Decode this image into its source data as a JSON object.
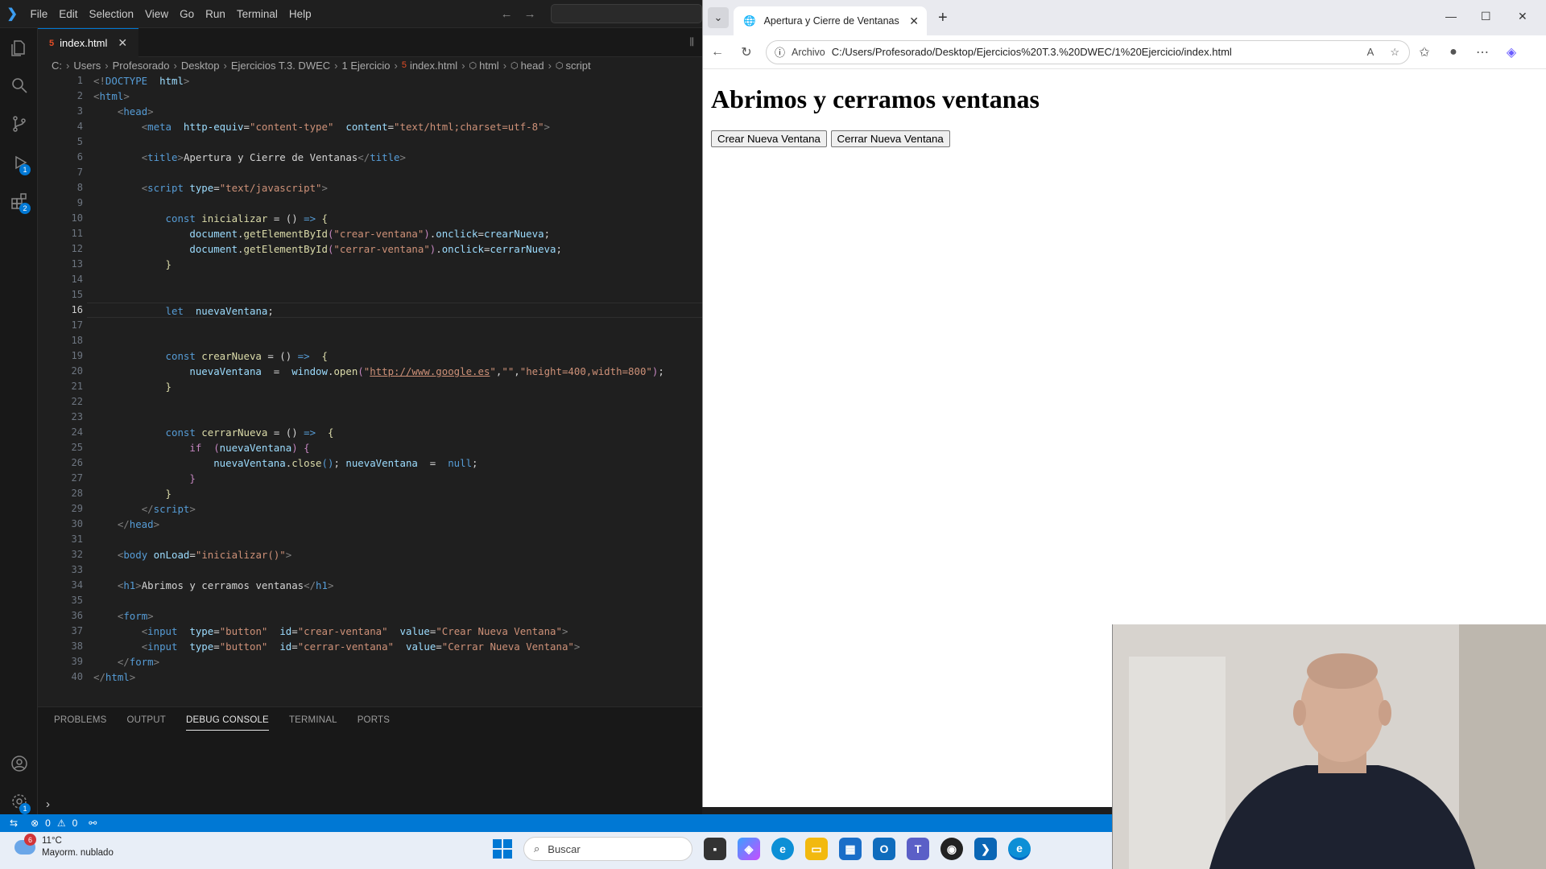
{
  "vscode": {
    "menu": [
      "File",
      "Edit",
      "Selection",
      "View",
      "Go",
      "Run",
      "Terminal",
      "Help"
    ],
    "tab": {
      "filename": "index.html"
    },
    "breadcrumb": {
      "c": "C:",
      "users": "Users",
      "prof": "Profesorado",
      "desk": "Desktop",
      "ej": "Ejercicios T.3. DWEC",
      "ej1": "1 Ejercicio",
      "file": "index.html",
      "html": "html",
      "head": "head",
      "script": "script"
    },
    "activity_badges": {
      "debug": "1",
      "extensions": "2",
      "settings": "1"
    },
    "current_line": 16,
    "panel_tabs": [
      "PROBLEMS",
      "OUTPUT",
      "DEBUG CONSOLE",
      "TERMINAL",
      "PORTS"
    ],
    "active_panel_tab": "DEBUG CONSOLE",
    "status": {
      "errors": "0",
      "warnings": "0"
    },
    "code": [
      [
        [
          "t",
          "<!"
        ],
        [
          "tg",
          "DOCTYPE"
        ],
        [
          "tx",
          "  "
        ],
        [
          "at",
          "html"
        ],
        [
          "t",
          ">"
        ]
      ],
      [
        [
          "t",
          "<"
        ],
        [
          "tg",
          "html"
        ],
        [
          "t",
          ">"
        ]
      ],
      [
        [
          "tx",
          "    "
        ],
        [
          "t",
          "<"
        ],
        [
          "tg",
          "head"
        ],
        [
          "t",
          ">"
        ]
      ],
      [
        [
          "tx",
          "        "
        ],
        [
          "t",
          "<"
        ],
        [
          "tg",
          "meta"
        ],
        [
          "tx",
          "  "
        ],
        [
          "at",
          "http-equiv"
        ],
        [
          "tx",
          "="
        ],
        [
          "st",
          "\"content-type\""
        ],
        [
          "tx",
          "  "
        ],
        [
          "at",
          "content"
        ],
        [
          "tx",
          "="
        ],
        [
          "st",
          "\"text/html;charset=utf-8\""
        ],
        [
          "t",
          ">"
        ]
      ],
      [],
      [
        [
          "tx",
          "        "
        ],
        [
          "t",
          "<"
        ],
        [
          "tg",
          "title"
        ],
        [
          "t",
          ">"
        ],
        [
          "tx",
          "Apertura y Cierre de Ventanas"
        ],
        [
          "t",
          "</"
        ],
        [
          "tg",
          "title"
        ],
        [
          "t",
          ">"
        ]
      ],
      [],
      [
        [
          "tx",
          "        "
        ],
        [
          "t",
          "<"
        ],
        [
          "tg",
          "script"
        ],
        [
          "tx",
          " "
        ],
        [
          "at",
          "type"
        ],
        [
          "tx",
          "="
        ],
        [
          "st",
          "\"text/javascript\""
        ],
        [
          "t",
          ">"
        ]
      ],
      [],
      [
        [
          "tx",
          "            "
        ],
        [
          "kw",
          "const "
        ],
        [
          "fn",
          "inicializar"
        ],
        [
          "tx",
          " = () "
        ],
        [
          "kw",
          "=>"
        ],
        [
          "tx",
          " "
        ],
        [
          "fn",
          "{"
        ]
      ],
      [
        [
          "tx",
          "                "
        ],
        [
          "vr",
          "document"
        ],
        [
          "tx",
          "."
        ],
        [
          "fn",
          "getElementById"
        ],
        [
          "ct",
          "("
        ],
        [
          "st",
          "\"crear-ventana\""
        ],
        [
          "ct",
          ")"
        ],
        [
          "tx",
          "."
        ],
        [
          "vr",
          "onclick"
        ],
        [
          "tx",
          "="
        ],
        [
          "vr",
          "crearNueva"
        ],
        [
          "tx",
          ";"
        ]
      ],
      [
        [
          "tx",
          "                "
        ],
        [
          "vr",
          "document"
        ],
        [
          "tx",
          "."
        ],
        [
          "fn",
          "getElementById"
        ],
        [
          "ct",
          "("
        ],
        [
          "st",
          "\"cerrar-ventana\""
        ],
        [
          "ct",
          ")"
        ],
        [
          "tx",
          "."
        ],
        [
          "vr",
          "onclick"
        ],
        [
          "tx",
          "="
        ],
        [
          "vr",
          "cerrarNueva"
        ],
        [
          "tx",
          ";"
        ]
      ],
      [
        [
          "tx",
          "            "
        ],
        [
          "fn",
          "}"
        ]
      ],
      [],
      [],
      [
        [
          "tx",
          "            "
        ],
        [
          "kw",
          "let"
        ],
        [
          "tx",
          "  "
        ],
        [
          "vr",
          "nuevaVentana"
        ],
        [
          "tx",
          ";"
        ]
      ],
      [],
      [],
      [
        [
          "tx",
          "            "
        ],
        [
          "kw",
          "const "
        ],
        [
          "fn",
          "crearNueva"
        ],
        [
          "tx",
          " = () "
        ],
        [
          "kw",
          "=>"
        ],
        [
          "tx",
          "  "
        ],
        [
          "fn",
          "{"
        ]
      ],
      [
        [
          "tx",
          "                "
        ],
        [
          "vr",
          "nuevaVentana"
        ],
        [
          "tx",
          "  =  "
        ],
        [
          "vr",
          "window"
        ],
        [
          "tx",
          "."
        ],
        [
          "fn",
          "open"
        ],
        [
          "ct",
          "("
        ],
        [
          "st",
          "\""
        ],
        [
          "stu",
          "http://www.google.es"
        ],
        [
          "st",
          "\""
        ],
        [
          "tx",
          ","
        ],
        [
          "st",
          "\"\""
        ],
        [
          "tx",
          ","
        ],
        [
          "st",
          "\"height=400,width=800\""
        ],
        [
          "ct",
          ")"
        ],
        [
          "tx",
          ";"
        ]
      ],
      [
        [
          "tx",
          "            "
        ],
        [
          "fn",
          "}"
        ]
      ],
      [],
      [],
      [
        [
          "tx",
          "            "
        ],
        [
          "kw",
          "const "
        ],
        [
          "fn",
          "cerrarNueva"
        ],
        [
          "tx",
          " = () "
        ],
        [
          "kw",
          "=>"
        ],
        [
          "tx",
          "  "
        ],
        [
          "fn",
          "{"
        ]
      ],
      [
        [
          "tx",
          "                "
        ],
        [
          "ct",
          "if"
        ],
        [
          "tx",
          "  "
        ],
        [
          "ct",
          "("
        ],
        [
          "vr",
          "nuevaVentana"
        ],
        [
          "ct",
          ")"
        ],
        [
          "tx",
          " "
        ],
        [
          "ct",
          "{"
        ]
      ],
      [
        [
          "tx",
          "                    "
        ],
        [
          "vr",
          "nuevaVentana"
        ],
        [
          "tx",
          "."
        ],
        [
          "fn",
          "close"
        ],
        [
          "kw",
          "()"
        ],
        [
          "tx",
          "; "
        ],
        [
          "vr",
          "nuevaVentana"
        ],
        [
          "tx",
          "  =  "
        ],
        [
          "kw",
          "null"
        ],
        [
          "tx",
          ";"
        ]
      ],
      [
        [
          "tx",
          "                "
        ],
        [
          "ct",
          "}"
        ]
      ],
      [
        [
          "tx",
          "            "
        ],
        [
          "fn",
          "}"
        ]
      ],
      [
        [
          "tx",
          "        "
        ],
        [
          "t",
          "</"
        ],
        [
          "tg",
          "script"
        ],
        [
          "t",
          ">"
        ]
      ],
      [
        [
          "tx",
          "    "
        ],
        [
          "t",
          "</"
        ],
        [
          "tg",
          "head"
        ],
        [
          "t",
          ">"
        ]
      ],
      [],
      [
        [
          "tx",
          "    "
        ],
        [
          "t",
          "<"
        ],
        [
          "tg",
          "body"
        ],
        [
          "tx",
          " "
        ],
        [
          "at",
          "onLoad"
        ],
        [
          "tx",
          "="
        ],
        [
          "st",
          "\"inicializar()\""
        ],
        [
          "t",
          ">"
        ]
      ],
      [],
      [
        [
          "tx",
          "    "
        ],
        [
          "t",
          "<"
        ],
        [
          "tg",
          "h1"
        ],
        [
          "t",
          ">"
        ],
        [
          "tx",
          "Abrimos y cerramos ventanas"
        ],
        [
          "t",
          "</"
        ],
        [
          "tg",
          "h1"
        ],
        [
          "t",
          ">"
        ]
      ],
      [],
      [
        [
          "tx",
          "    "
        ],
        [
          "t",
          "<"
        ],
        [
          "tg",
          "form"
        ],
        [
          "t",
          ">"
        ]
      ],
      [
        [
          "tx",
          "        "
        ],
        [
          "t",
          "<"
        ],
        [
          "tg",
          "input"
        ],
        [
          "tx",
          "  "
        ],
        [
          "at",
          "type"
        ],
        [
          "tx",
          "="
        ],
        [
          "st",
          "\"button\""
        ],
        [
          "tx",
          "  "
        ],
        [
          "at",
          "id"
        ],
        [
          "tx",
          "="
        ],
        [
          "st",
          "\"crear-ventana\""
        ],
        [
          "tx",
          "  "
        ],
        [
          "at",
          "value"
        ],
        [
          "tx",
          "="
        ],
        [
          "st",
          "\"Crear Nueva Ventana\""
        ],
        [
          "t",
          ">"
        ]
      ],
      [
        [
          "tx",
          "        "
        ],
        [
          "t",
          "<"
        ],
        [
          "tg",
          "input"
        ],
        [
          "tx",
          "  "
        ],
        [
          "at",
          "type"
        ],
        [
          "tx",
          "="
        ],
        [
          "st",
          "\"button\""
        ],
        [
          "tx",
          "  "
        ],
        [
          "at",
          "id"
        ],
        [
          "tx",
          "="
        ],
        [
          "st",
          "\"cerrar-ventana\""
        ],
        [
          "tx",
          "  "
        ],
        [
          "at",
          "value"
        ],
        [
          "tx",
          "="
        ],
        [
          "st",
          "\"Cerrar Nueva Ventana\""
        ],
        [
          "t",
          ">"
        ]
      ],
      [
        [
          "tx",
          "    "
        ],
        [
          "t",
          "</"
        ],
        [
          "tg",
          "form"
        ],
        [
          "t",
          ">"
        ]
      ],
      [
        [
          "t",
          "</"
        ],
        [
          "tg",
          "html"
        ],
        [
          "t",
          ">"
        ]
      ]
    ]
  },
  "browser": {
    "tab_title": "Apertura y Cierre de Ventanas",
    "addr_label": "Archivo",
    "url": "C:/Users/Profesorado/Desktop/Ejercicios%20T.3.%20DWEC/1%20Ejercicio/index.html",
    "heading": "Abrimos y cerramos ventanas",
    "btn_crear": "Crear Nueva Ventana",
    "btn_cerrar": "Cerrar Nueva Ventana"
  },
  "taskbar": {
    "weather_badge": "6",
    "temp": "11°C",
    "condition": "Mayorm. nublado",
    "search_placeholder": "Buscar"
  }
}
